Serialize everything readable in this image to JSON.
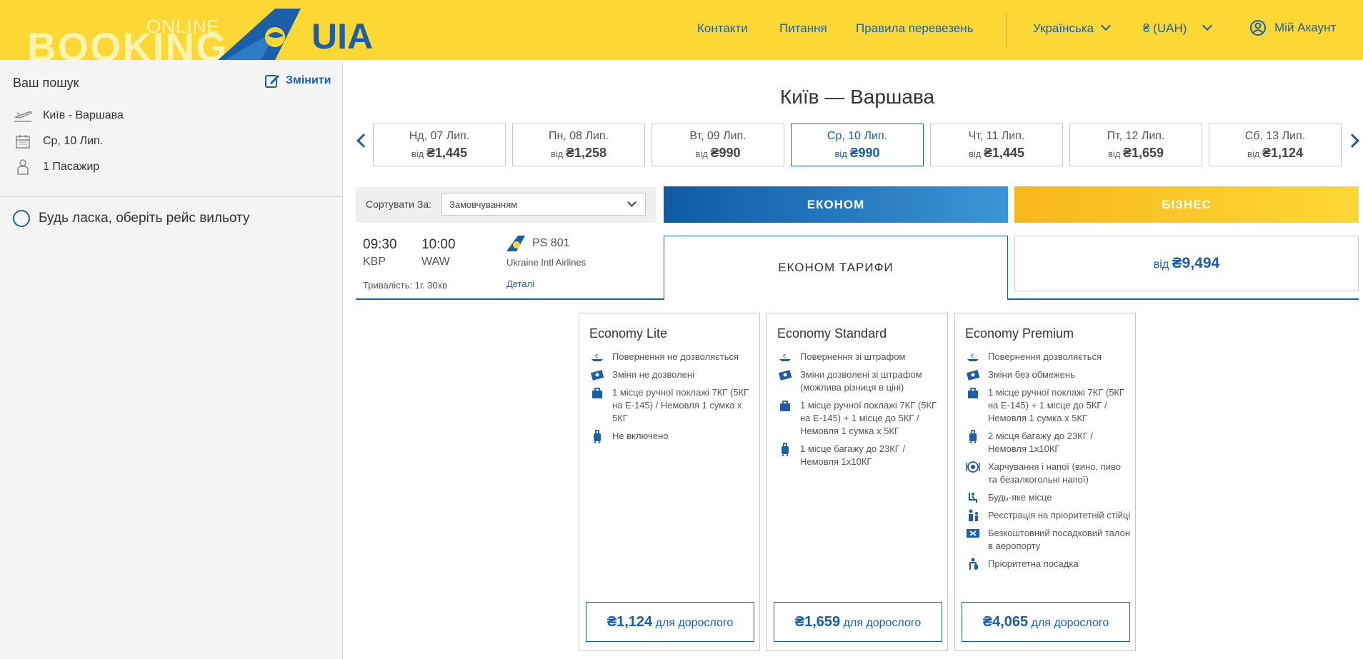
{
  "header": {
    "logo_online": "ONLINE",
    "logo_booking": "BOOKING",
    "logo_brand": "UIA",
    "nav": [
      "Контакти",
      "Питання",
      "Правила перевезень"
    ],
    "language": "Українська",
    "currency": "₴ (UAH)",
    "account": "Мій Акаунт"
  },
  "sidebar": {
    "title": "Ваш пошук",
    "edit_label": "Змінити",
    "route": "Київ - Варшава",
    "date": "Ср, 10 Лип.",
    "passengers": "1 Пасажир",
    "choose_prompt": "Будь ласка, оберіть рейс вильоту"
  },
  "main": {
    "route_title": "Київ — Варшава",
    "dates": [
      {
        "day": "Нд, 07 Лип.",
        "from": "від",
        "price": "₴1,445"
      },
      {
        "day": "Пн, 08 Лип.",
        "from": "від",
        "price": "₴1,258"
      },
      {
        "day": "Вт, 09 Лип.",
        "from": "від",
        "price": "₴990"
      },
      {
        "day": "Ср, 10 Лип.",
        "from": "від",
        "price": "₴990"
      },
      {
        "day": "Чт, 11 Лип.",
        "from": "від",
        "price": "₴1,445"
      },
      {
        "day": "Пт, 12 Лип.",
        "from": "від",
        "price": "₴1,659"
      },
      {
        "day": "Сб, 13 Лип.",
        "from": "від",
        "price": "₴1,124"
      }
    ],
    "sort_label": "Сортувати За:",
    "sort_value": "Замовчуванням",
    "tab_economy": "ЕКОНОМ",
    "tab_business": "БІЗНЕС",
    "flight": {
      "dep_time": "09:30",
      "arr_time": "10:00",
      "dep_code": "KBP",
      "arr_code": "WAW",
      "flight_no": "PS 801",
      "airline": "Ukraine Intl Airlines",
      "duration": "Тривалість: 1г. 30хв",
      "details": "Деталі"
    },
    "economy_fares_label": "ЕКОНОМ ТАРИФИ",
    "business_from_prefix": "від",
    "business_from_price": "₴9,494"
  },
  "fares": [
    {
      "name": "Economy Lite",
      "features": [
        {
          "icon": "refund-icon",
          "text": "Повернення не дозволяється"
        },
        {
          "icon": "ticket-change-icon",
          "text": "Зміни не дозволені"
        },
        {
          "icon": "hand-bag-icon",
          "text": "1 місце ручної поклажі 7КГ (5КГ на E-145) / Немовля 1 сумка х 5КГ"
        },
        {
          "icon": "luggage-icon",
          "text": "Не включено"
        }
      ],
      "price": "₴1,124",
      "price_suffix": "для дорослого"
    },
    {
      "name": "Economy Standard",
      "features": [
        {
          "icon": "refund-icon",
          "text": "Повернення зі штрафом"
        },
        {
          "icon": "ticket-change-icon",
          "text": "Зміни дозволені зі штрафом (можлива різниця в ціні)"
        },
        {
          "icon": "hand-bag-icon",
          "text": "1 місце ручної поклажі 7КГ (5КГ на E-145) + 1 місце до 5КГ / Немовля 1 сумка х 5КГ"
        },
        {
          "icon": "luggage-icon",
          "text": "1 місце багажу до 23КГ / Немовля 1х10КГ"
        }
      ],
      "price": "₴1,659",
      "price_suffix": "для дорослого"
    },
    {
      "name": "Economy Premium",
      "features": [
        {
          "icon": "refund-icon",
          "text": "Повернення дозволяється"
        },
        {
          "icon": "ticket-change-icon",
          "text": "Зміни без обмежень"
        },
        {
          "icon": "hand-bag-icon",
          "text": "1 місце ручної поклажі 7КГ (5КГ на E-145) + 1 місце до 5КГ / Немовля 1 сумка х 5КГ"
        },
        {
          "icon": "luggage-icon",
          "text": "2 місця багажу до 23КГ / Немовля 1х10КГ"
        },
        {
          "icon": "meal-icon",
          "text": "Харчування і напої (вино, пиво та безалкогольні напої)"
        },
        {
          "icon": "seat-icon",
          "text": "Будь-яке місце"
        },
        {
          "icon": "priority-checkin-icon",
          "text": "Реєстрація на пріоритетній стійці"
        },
        {
          "icon": "boarding-pass-icon",
          "text": "Безкоштовний посадковий талон в аеропорту"
        },
        {
          "icon": "priority-boarding-icon",
          "text": "Пріоритетна посадка"
        }
      ],
      "price": "₴4,065",
      "price_suffix": "для дорослого"
    }
  ],
  "colors": {
    "brand_yellow": "#fdd835",
    "brand_blue": "#1a5fa8"
  }
}
